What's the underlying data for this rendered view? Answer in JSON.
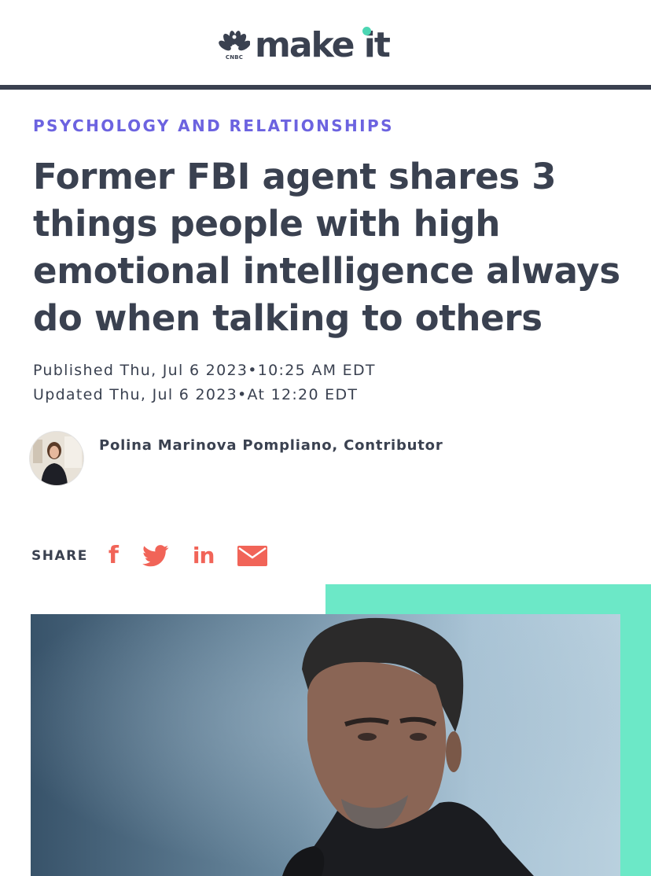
{
  "brand": {
    "network_mark": "CNBC",
    "name": "make it"
  },
  "article": {
    "category": "PSYCHOLOGY AND RELATIONSHIPS",
    "headline": "Former FBI agent shares 3 things people with high emotional intelligence always do when talking to others",
    "published": "Published Thu, Jul 6 2023•10:25 AM EDT",
    "updated": "Updated Thu, Jul 6 2023•At 12:20 EDT",
    "author": "Polina Marinova Pompliano, Contributor"
  },
  "share": {
    "label": "SHARE",
    "facebook_glyph": "f",
    "linkedin_glyph": "in",
    "icons": [
      "facebook-icon",
      "twitter-icon",
      "linkedin-icon",
      "email-icon"
    ]
  },
  "colors": {
    "text": "#3a4150",
    "category": "#6c63e0",
    "share_icons": "#f16458",
    "accent_mint": "#6ce8c7",
    "logo_dot": "#4cd6b3"
  }
}
